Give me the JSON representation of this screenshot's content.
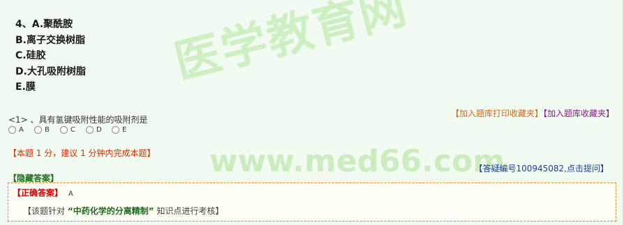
{
  "options": [
    "4、A.聚酰胺",
    "B.离子交换树脂",
    "C.硅胶",
    "D.大孔吸附树脂",
    "E.膜"
  ],
  "watermark": {
    "text_cn": "医学教育网",
    "text_url": "www.med66.com"
  },
  "links": {
    "print_fav": "【加入题库打印收藏夹】",
    "fav": "【加入题库收藏夹】"
  },
  "question": {
    "text": "<1> 、具有氢键吸附性能的吸附剂是",
    "choices": [
      "A",
      "B",
      "C",
      "D",
      "E"
    ]
  },
  "meta": "【本题 1 分，建议 1 分钟内完成本题】",
  "ask": "【答疑编号100945082,点击提问】",
  "hide_answer": "【隐藏答案】",
  "answer": {
    "label": "【正确答案】",
    "value": "A",
    "hint_prefix": "【该题针对",
    "knowledge_point": "“中药化学的分离精制”",
    "hint_suffix": "知识点进行考核】"
  }
}
